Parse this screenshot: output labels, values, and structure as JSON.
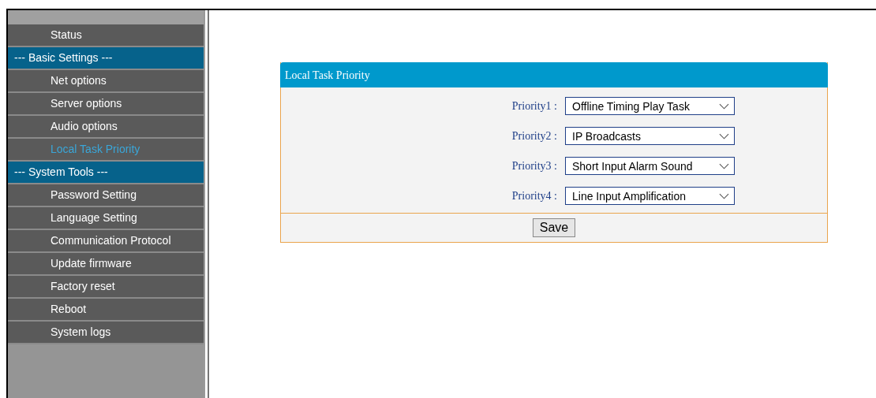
{
  "sidebar": {
    "items": [
      {
        "kind": "item",
        "label": "Status",
        "selected": false
      },
      {
        "kind": "section",
        "label": "--- Basic Settings ---"
      },
      {
        "kind": "item",
        "label": "Net options",
        "selected": false
      },
      {
        "kind": "item",
        "label": "Server options",
        "selected": false
      },
      {
        "kind": "item",
        "label": "Audio options",
        "selected": false
      },
      {
        "kind": "item",
        "label": "Local Task Priority",
        "selected": true
      },
      {
        "kind": "section",
        "label": "--- System Tools ---"
      },
      {
        "kind": "item",
        "label": "Password Setting",
        "selected": false
      },
      {
        "kind": "item",
        "label": "Language Setting",
        "selected": false
      },
      {
        "kind": "item",
        "label": "Communication Protocol",
        "selected": false
      },
      {
        "kind": "item",
        "label": "Update firmware",
        "selected": false
      },
      {
        "kind": "item",
        "label": "Factory reset",
        "selected": false
      },
      {
        "kind": "item",
        "label": "Reboot",
        "selected": false
      },
      {
        "kind": "item",
        "label": "System logs",
        "selected": false
      }
    ]
  },
  "panel": {
    "title": "Local Task Priority",
    "fields": [
      {
        "label": "Priority1 :",
        "value": "Offline Timing Play Task"
      },
      {
        "label": "Priority2 :",
        "value": "IP Broadcasts"
      },
      {
        "label": "Priority3 :",
        "value": "Short Input Alarm Sound"
      },
      {
        "label": "Priority4 :",
        "value": "Line Input Amplification"
      }
    ],
    "button": "Save"
  }
}
